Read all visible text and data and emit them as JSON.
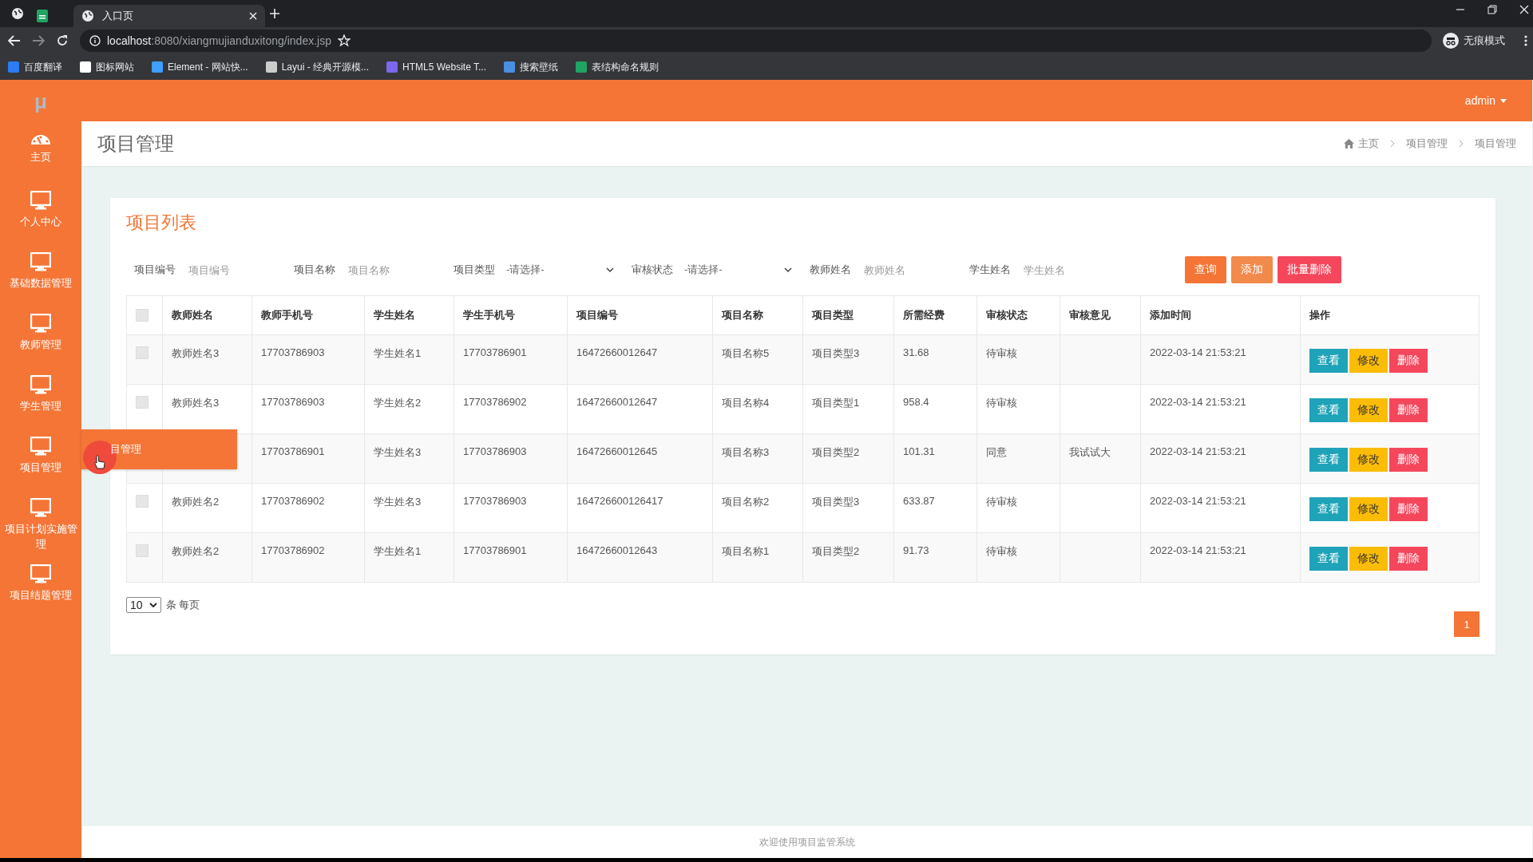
{
  "browser": {
    "tabs": [
      {
        "kind": "app",
        "selected": false
      },
      {
        "kind": "page",
        "title": "入口页",
        "selected": true
      }
    ],
    "url_host": "localhost",
    "url_path": ":8080/xiangmujianduxitong/index.jsp",
    "incognito": "无痕模式",
    "bookmarks": [
      {
        "title": "百度翻译",
        "color": "#2b7cf6"
      },
      {
        "title": "图标网站",
        "color": "#ffffff"
      },
      {
        "title": "Element - 网站快...",
        "color": "#409eff"
      },
      {
        "title": "Layui - 经典开源模...",
        "color": "#cccccc"
      },
      {
        "title": "HTML5 Website T...",
        "color": "#7b68ee"
      },
      {
        "title": "搜索壁纸",
        "color": "#4a90e2"
      },
      {
        "title": "表结构命名规则",
        "color": "#1fa463"
      }
    ]
  },
  "header": {
    "logo": "μ",
    "user": "admin"
  },
  "sidebar": {
    "items": [
      {
        "label": "主页",
        "kind": "dashboard"
      },
      {
        "label": "个人中心",
        "kind": "monitor"
      },
      {
        "label": "基础数据管理",
        "kind": "monitor"
      },
      {
        "label": "教师管理",
        "kind": "monitor"
      },
      {
        "label": "学生管理",
        "kind": "monitor"
      },
      {
        "label": "项目管理",
        "kind": "monitor"
      },
      {
        "label": "项目计划实施管理",
        "kind": "monitor"
      },
      {
        "label": "项目结题管理",
        "kind": "monitor"
      }
    ],
    "flyout": "目管理"
  },
  "page_title": "项目管理",
  "breadcrumbs": [
    "主页",
    "项目管理",
    "项目管理"
  ],
  "card": {
    "title": "项目列表",
    "filters": [
      {
        "label": "项目编号",
        "kind": "input",
        "placeholder": "项目编号"
      },
      {
        "label": "项目名称",
        "kind": "input",
        "placeholder": "项目名称"
      },
      {
        "label": "项目类型",
        "kind": "select",
        "value": "-请选择-"
      },
      {
        "label": "审核状态",
        "kind": "select",
        "value": "-请选择-"
      },
      {
        "label": "教师姓名",
        "kind": "input",
        "placeholder": "教师姓名"
      },
      {
        "label": "学生姓名",
        "kind": "input",
        "placeholder": "学生姓名"
      }
    ],
    "buttons": [
      {
        "label": "查询",
        "kind": "query"
      },
      {
        "label": "添加",
        "kind": "add"
      },
      {
        "label": "批量删除",
        "kind": "delete"
      }
    ],
    "table": {
      "all_checked": false,
      "columns": [
        "教师姓名",
        "教师手机号",
        "学生姓名",
        "学生手机号",
        "项目编号",
        "项目名称",
        "项目类型",
        "所需经费",
        "审核状态",
        "审核意见",
        "添加时间",
        "操作"
      ],
      "rows": [
        {
          "checked": false,
          "teacher_name": "教师姓名3",
          "teacher_phone": "17703786903",
          "student_name": "学生姓名1",
          "student_phone": "17703786901",
          "project_no": "16472660012647",
          "project_name": "项目名称5",
          "project_type": "项目类型3",
          "funding": "31.68",
          "review_status": "待审核",
          "added_time": "2022-03-14 21:53:21",
          "actions": [
            {
              "label": "查看",
              "kind": "view"
            },
            {
              "label": "修改",
              "kind": "edit"
            },
            {
              "label": "删除",
              "kind": "delete"
            }
          ]
        },
        {
          "checked": false,
          "teacher_name": "教师姓名3",
          "teacher_phone": "17703786903",
          "student_name": "学生姓名2",
          "student_phone": "17703786902",
          "project_no": "16472660012647",
          "project_name": "项目名称4",
          "project_type": "项目类型1",
          "funding": "958.4",
          "review_status": "待审核",
          "added_time": "2022-03-14 21:53:21",
          "actions": [
            {
              "label": "查看",
              "kind": "view"
            },
            {
              "label": "修改",
              "kind": "edit"
            },
            {
              "label": "删除",
              "kind": "delete"
            }
          ]
        },
        {
          "teacher_phone": "17703786901",
          "student_name": "学生姓名3",
          "student_phone": "17703786903",
          "project_no": "16472660012645",
          "project_name": "项目名称3",
          "project_type": "项目类型2",
          "funding": "101.31",
          "review_status": "同意",
          "review_comment": "我试试大",
          "added_time": "2022-03-14 21:53:21",
          "actions": [
            {
              "label": "查看",
              "kind": "view"
            },
            {
              "label": "修改",
              "kind": "edit"
            },
            {
              "label": "删除",
              "kind": "delete"
            }
          ]
        },
        {
          "checked": false,
          "teacher_name": "教师姓名2",
          "teacher_phone": "17703786902",
          "student_name": "学生姓名3",
          "student_phone": "17703786903",
          "project_no": "164726600126417",
          "project_name": "项目名称2",
          "project_type": "项目类型3",
          "funding": "633.87",
          "review_status": "待审核",
          "added_time": "2022-03-14 21:53:21",
          "actions": [
            {
              "label": "查看",
              "kind": "view"
            },
            {
              "label": "修改",
              "kind": "edit"
            },
            {
              "label": "删除",
              "kind": "delete"
            }
          ]
        },
        {
          "checked": false,
          "teacher_name": "教师姓名2",
          "teacher_phone": "17703786902",
          "student_name": "学生姓名1",
          "student_phone": "17703786901",
          "project_no": "16472660012643",
          "project_name": "项目名称1",
          "project_type": "项目类型2",
          "funding": "91.73",
          "review_status": "待审核",
          "added_time": "2022-03-14 21:53:21",
          "actions": [
            {
              "label": "查看",
              "kind": "view"
            },
            {
              "label": "修改",
              "kind": "edit"
            },
            {
              "label": "删除",
              "kind": "delete"
            }
          ]
        }
      ]
    },
    "page_size": "10",
    "page_size_suffix": "条 每页",
    "pages": [
      {
        "label": "1",
        "selected": true
      }
    ]
  },
  "footer": "欢迎使用项目监管系统"
}
